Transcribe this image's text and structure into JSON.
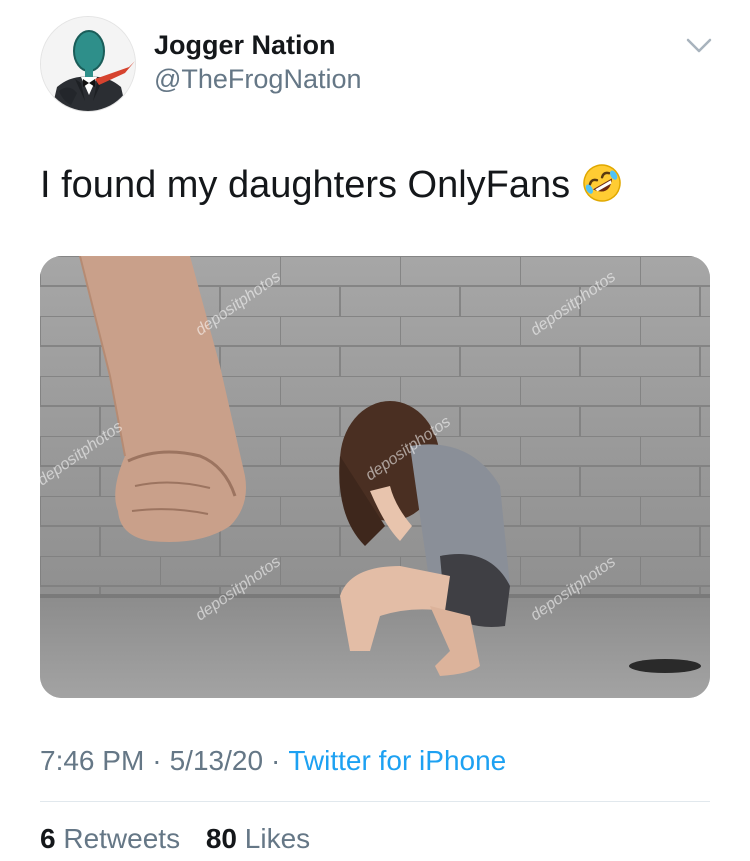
{
  "tweet": {
    "display_name": "Jogger Nation",
    "handle": "@TheFrogNation",
    "text": "I found my daughters OnlyFans",
    "emoji": "rolling-on-the-floor-laughing-emoji",
    "media": {
      "watermark": "depositphotos"
    },
    "time": "7:46 PM",
    "separator": "·",
    "date": "5/13/20",
    "source": "Twitter for iPhone",
    "retweets_count": "6",
    "retweets_label": "Retweets",
    "likes_count": "80",
    "likes_label": "Likes"
  },
  "colors": {
    "text_primary": "#14171a",
    "text_secondary": "#657786",
    "link": "#1da1f2",
    "divider": "#e1e8ed"
  },
  "icons": {
    "menu": "chevron-down-icon"
  }
}
